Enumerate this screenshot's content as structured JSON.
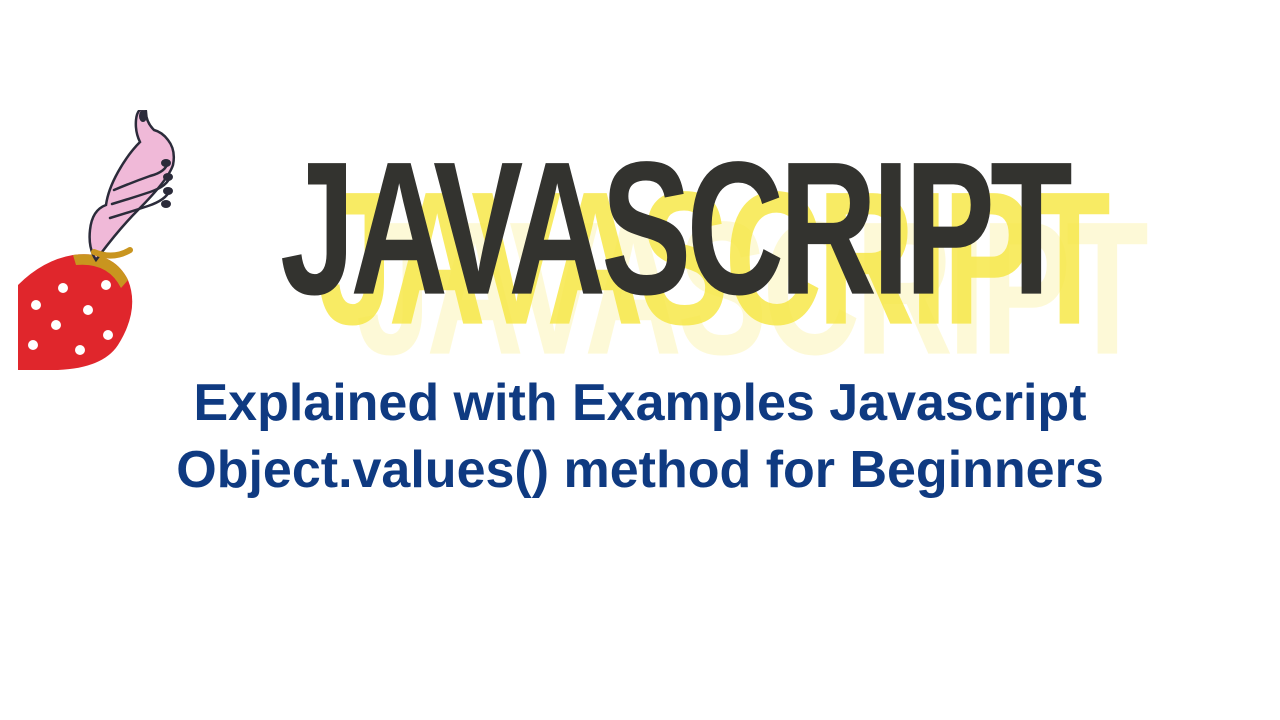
{
  "hero": {
    "title": "JAVASCRIPT"
  },
  "subtitle": {
    "text": "Explained with Examples Javascript Object.values() method for Beginners"
  },
  "colors": {
    "title_main": "#33332f",
    "title_shadow": "#f7e84a",
    "subtitle": "#0f3a81",
    "sleeve": "#e0262c",
    "skin": "#f0b9d8",
    "nail": "#2b2b3a"
  }
}
